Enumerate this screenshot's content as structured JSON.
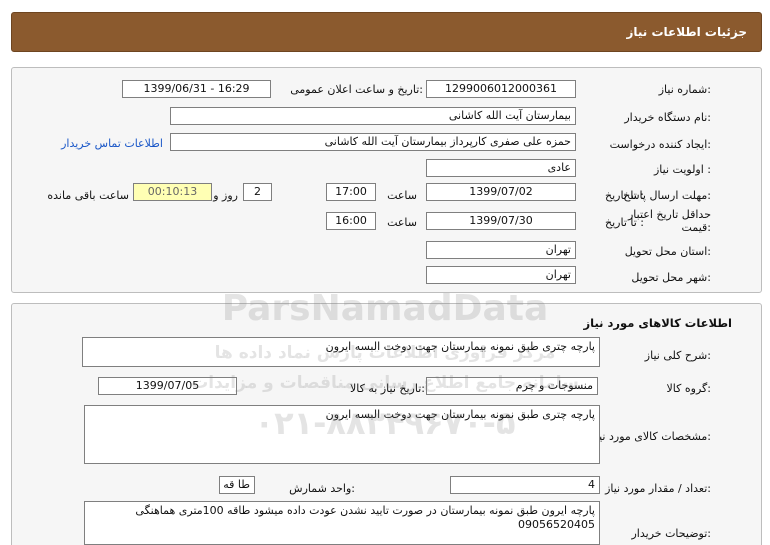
{
  "header": {
    "title": "جزئیات اطلاعات نیاز"
  },
  "need_info": {
    "need_number_label": "شماره نیاز:",
    "need_number": "1299006012000361",
    "announce_label": "تاریخ و ساعت اعلان عمومی:",
    "announce_value": "1399/06/31 - 16:29",
    "buyer_org_label": "نام دستگاه خریدار:",
    "buyer_org": "بیمارستان آیت الله کاشانی",
    "creator_label": "ایجاد کننده درخواست:",
    "creator": "حمزه علی صفری کارپرداز بیمارستان آیت الله کاشانی",
    "contact_link": "اطلاعات تماس خریدار",
    "priority_label": "اولویت نیاز :",
    "priority": "عادی",
    "deadline_label": "مهلت ارسال پاسخ:",
    "to_date_label": "تا تاریخ :",
    "deadline_date": "1399/07/02",
    "time_label": "ساعت",
    "deadline_time": "17:00",
    "days_value": "2",
    "days_label": "روز و",
    "remaining_time": "00:10:13",
    "remaining_label": "ساعت باقی مانده",
    "validity_label": "حداقل تاریخ اعتبار قیمت:",
    "validity_to_label": "تا تاریخ :",
    "validity_date": "1399/07/30",
    "validity_time_label": "ساعت",
    "validity_time": "16:00",
    "province_label": "استان محل تحویل:",
    "province": "تهران",
    "city_label": "شهر محل تحویل:",
    "city": "تهران"
  },
  "goods": {
    "section_title": "اطلاعات کالاهای مورد نیاز",
    "summary_label": "شرح کلی نیاز:",
    "summary": "پارچه چتری طبق نمونه بیمارستان جهت دوخت البسه ایرون",
    "group_label": "گروه کالا:",
    "group": "منسوجات و چرم",
    "need_date_label": "تاریخ نیاز به کالا:",
    "need_date": "1399/07/05",
    "specs_label": "مشخصات کالای مورد نیاز:",
    "specs": "پارچه چتری طبق نمونه بیمارستان جهت دوخت البسه ایرون",
    "qty_label": "تعداد / مقدار مورد نیاز:",
    "qty": "4",
    "unit_label": "واحد شمارش:",
    "unit": "طا قه",
    "buyer_desc_label": "توضیحات خریدار:",
    "buyer_desc": "پارچه ایرون طبق نمونه  بیمارستان  در صورت تایید نشدن عودت داده  میشود طاقه 100متری هماهنگی 09056520405"
  },
  "watermark": {
    "brand": "ParsNamadData",
    "tagline": "مرکز فراوری اطلاعات پارس نماد داده ها",
    "tagline2": "سامانه جامع اطلاع رسانی مناقصات و مزایدات",
    "phone": "۰۲۱-۸۸۳۴۹۶۷۰-۵"
  },
  "colors": {
    "header_bg": "#8b5a2e",
    "link": "#1a57c8",
    "remaining_bg": "#ffffb4"
  }
}
